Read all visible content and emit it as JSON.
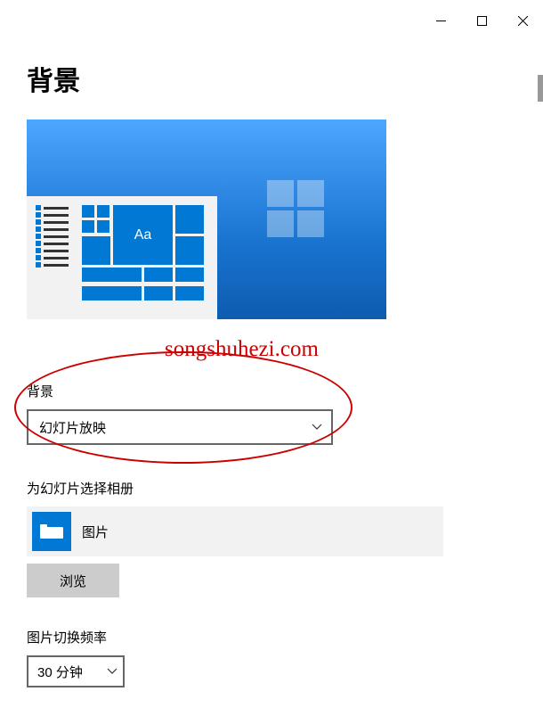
{
  "window": {
    "page_title": "背景"
  },
  "preview": {
    "aa_label": "Aa"
  },
  "watermark": "songshuhezi.com",
  "background_section": {
    "label": "背景",
    "dropdown_value": "幻灯片放映"
  },
  "album_section": {
    "label": "为幻灯片选择相册",
    "album_name": "图片",
    "browse_label": "浏览"
  },
  "frequency_section": {
    "label": "图片切换频率",
    "dropdown_value": "30 分钟"
  }
}
